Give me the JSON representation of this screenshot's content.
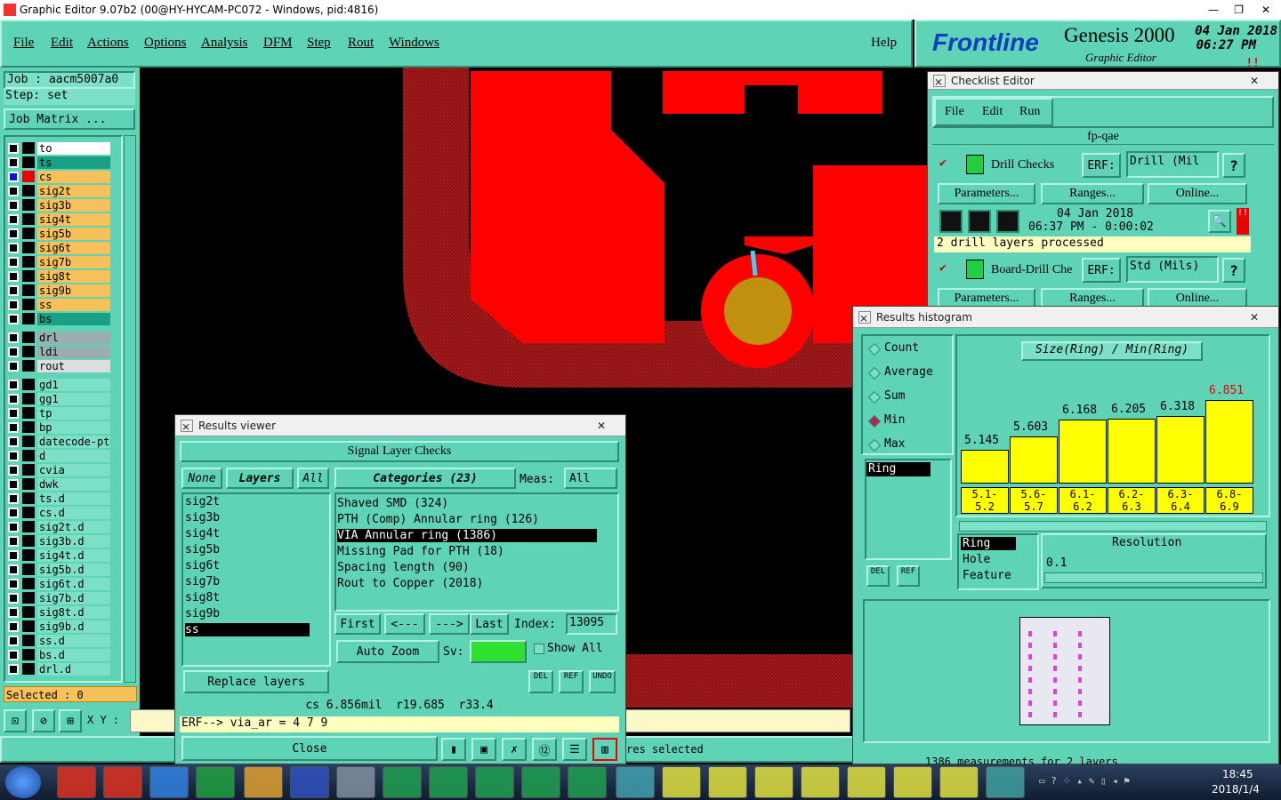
{
  "window": {
    "title": "Graphic Editor 9.07b2 (00@HY-HYCAM-PC072 - Windows, pid:4816)"
  },
  "menu": [
    "File",
    "Edit",
    "Actions",
    "Options",
    "Analysis",
    "DFM",
    "Step",
    "Rout",
    "Windows"
  ],
  "help": "Help",
  "brand": {
    "name": "Frontline",
    "product": "Genesis 2000",
    "sub": "Graphic Editor",
    "date": "04 Jan 2018",
    "time": "06:27 PM"
  },
  "job": {
    "job_label": "Job : aacm5007a0",
    "step_label": "Step: set",
    "matrix_btn": "Job Matrix ..."
  },
  "layers": [
    {
      "name": "to",
      "bg": "#ffffff"
    },
    {
      "name": "ts",
      "bg": "#1aa085"
    },
    {
      "name": "cs",
      "bg": "#f6c15a"
    },
    {
      "name": "sig2t",
      "bg": "#f6c15a"
    },
    {
      "name": "sig3b",
      "bg": "#f6c15a"
    },
    {
      "name": "sig4t",
      "bg": "#f6c15a"
    },
    {
      "name": "sig5b",
      "bg": "#f6c15a"
    },
    {
      "name": "sig6t",
      "bg": "#f6c15a"
    },
    {
      "name": "sig7b",
      "bg": "#f6c15a"
    },
    {
      "name": "sig8t",
      "bg": "#f6c15a"
    },
    {
      "name": "sig9b",
      "bg": "#f6c15a"
    },
    {
      "name": "ss",
      "bg": "#f6c15a"
    },
    {
      "name": "bs",
      "bg": "#1aa085"
    }
  ],
  "drill_layers": [
    {
      "name": "drl",
      "bg": "#9aaeb0"
    },
    {
      "name": "ldi",
      "bg": "#9aaeb0"
    },
    {
      "name": "rout",
      "bg": "#dddddd"
    }
  ],
  "other_layers": [
    "gd1",
    "gg1",
    "tp",
    "bp",
    "datecode-pt",
    "d",
    "cvia",
    "dwk",
    "ts.d",
    "cs.d",
    "sig2t.d",
    "sig3b.d",
    "sig4t.d",
    "sig5b.d",
    "sig6t.d",
    "sig7b.d",
    "sig8t.d",
    "sig9b.d",
    "ss.d",
    "bs.d",
    "drl.d"
  ],
  "selected": "Selected : 0",
  "coords": {
    "label": "X Y :"
  },
  "status": "res selected",
  "checklist": {
    "title": "Checklist Editor",
    "menu": [
      "File",
      "Edit",
      "Run"
    ],
    "name": "fp-qae",
    "checks": [
      {
        "name": "Drill Checks",
        "erf": "ERF:",
        "range": "Drill (Mil",
        "params": "Parameters...",
        "ranges": "Ranges...",
        "online": "Online...",
        "date": "04 Jan 2018",
        "time": "06:37 PM - 0:00:02",
        "msg": "2 drill layers processed"
      },
      {
        "name": "Board-Drill Che",
        "erf": "ERF:",
        "range": "Std (Mils)",
        "params": "Parameters...",
        "ranges": "Ranges...",
        "online": "Online..."
      }
    ]
  },
  "results_viewer": {
    "title": "Results viewer",
    "header": "Signal Layer Checks",
    "none": "None",
    "layers_btn": "Layers",
    "all": "All",
    "categories": "Categories (23)",
    "meas_label": "Meas:",
    "meas_val": "All",
    "layers": [
      "sig2t",
      "sig3b",
      "sig4t",
      "sig5b",
      "sig6t",
      "sig7b",
      "sig8t",
      "sig9b",
      "ss"
    ],
    "cats": [
      "Shaved SMD (324)",
      "PTH (Comp) Annular ring (126)",
      "VIA Annular ring (1386)",
      "Missing Pad for PTH (18)",
      "Spacing length (90)",
      "Rout to Copper (2018)"
    ],
    "first": "First",
    "prev": "<---",
    "next": "--->",
    "last": "Last",
    "index_label": "Index:",
    "index_val": "13095",
    "autozoom": "Auto Zoom",
    "sv": "Sv:",
    "showall": "Show All",
    "replace": "Replace layers",
    "info": "cs 6.856mil  r19.685  r33.4",
    "erf": "ERF--> via_ar = 4 7 9",
    "close": "Close",
    "del": "DEL",
    "ref": "REF",
    "undo": "UNDO"
  },
  "histogram": {
    "title": "Results histogram",
    "modes": [
      "Count",
      "Average",
      "Sum",
      "Min",
      "Max"
    ],
    "active": "Min",
    "metric": "Size(Ring) / Min(Ring)",
    "bars": [
      {
        "v": "5.145",
        "r": "5.1-\n5.2",
        "val": 5.145
      },
      {
        "v": "5.603",
        "r": "5.6-\n5.7",
        "val": 5.603
      },
      {
        "v": "6.168",
        "r": "6.1-\n6.2",
        "val": 6.168
      },
      {
        "v": "6.205",
        "r": "6.2-\n6.3",
        "val": 6.205
      },
      {
        "v": "6.318",
        "r": "6.3-\n6.4",
        "val": 6.318
      },
      {
        "v": "6.851",
        "r": "6.8-\n6.9",
        "val": 6.851
      }
    ],
    "ring_sel": "Ring",
    "fields": [
      "Ring",
      "Hole",
      "Feature"
    ],
    "resolution_label": "Resolution",
    "resolution": "0.1",
    "del": "DEL",
    "ref": "REF",
    "footer": "1386 measurements for 2 layers"
  },
  "clock": {
    "time": "18:45",
    "date": "2018/1/4"
  }
}
